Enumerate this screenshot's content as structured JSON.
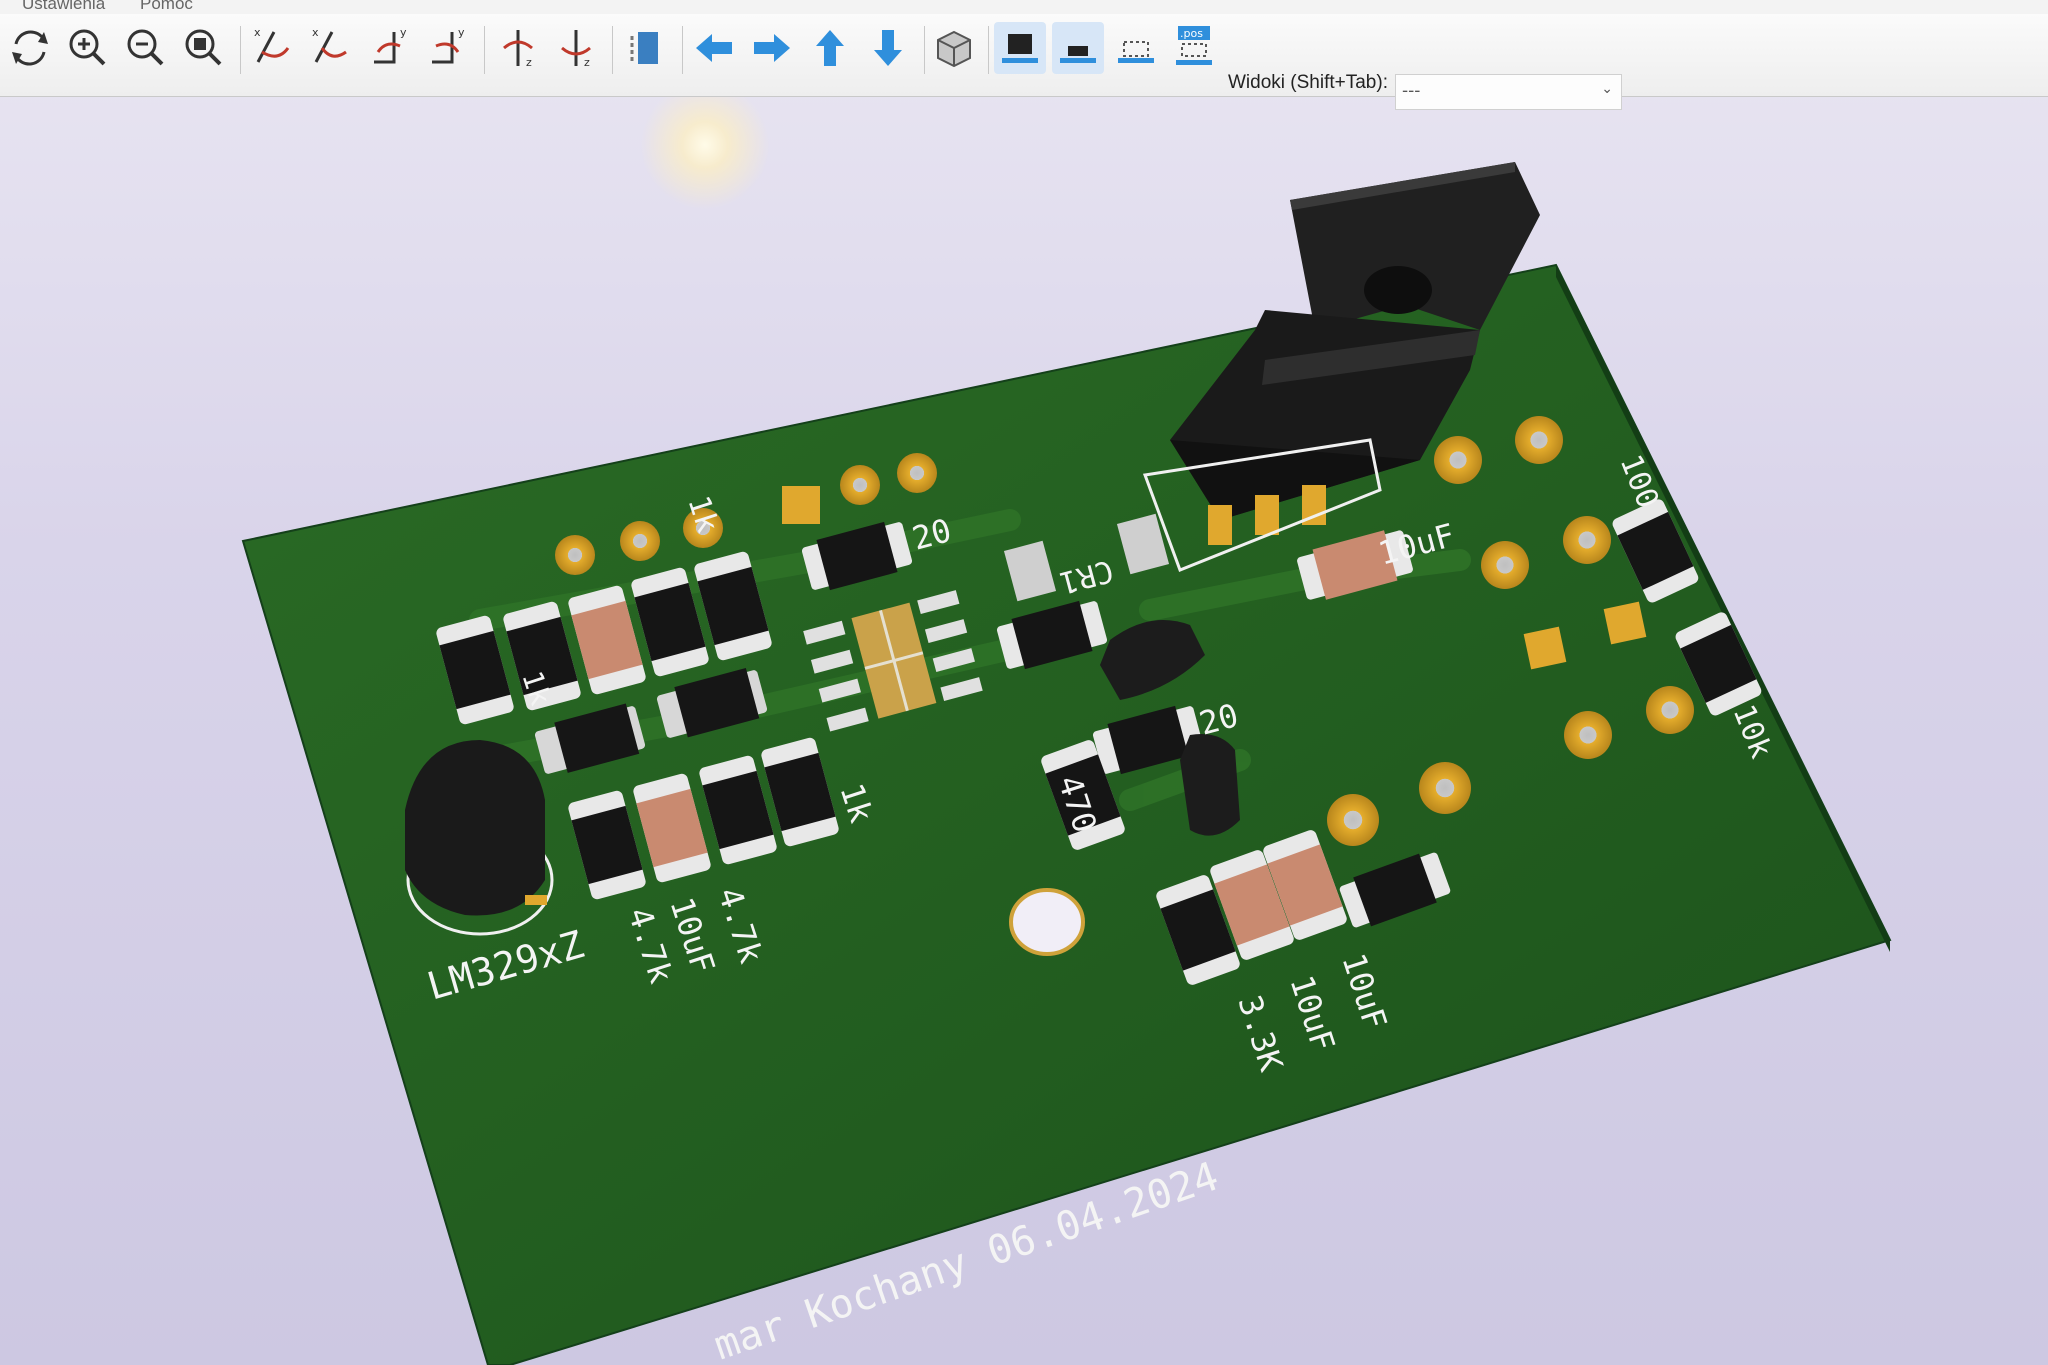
{
  "menu": {
    "items": [
      "Ustawienia",
      "Pomoc"
    ]
  },
  "toolbar": {
    "buttons": [
      {
        "name": "reload-board",
        "icon": "refresh-icon"
      },
      {
        "name": "zoom-in",
        "icon": "zoom-in-icon"
      },
      {
        "name": "zoom-out",
        "icon": "zoom-out-icon"
      },
      {
        "name": "zoom-fit",
        "icon": "zoom-fit-icon"
      },
      {
        "name": "rotate-x-cw",
        "icon": "rotate-x-cw-icon"
      },
      {
        "name": "rotate-x-ccw",
        "icon": "rotate-x-ccw-icon"
      },
      {
        "name": "rotate-y-cw",
        "icon": "rotate-y-cw-icon"
      },
      {
        "name": "rotate-y-ccw",
        "icon": "rotate-y-ccw-icon"
      },
      {
        "name": "rotate-z-cw",
        "icon": "rotate-z-cw-icon"
      },
      {
        "name": "rotate-z-ccw",
        "icon": "rotate-z-ccw-icon"
      },
      {
        "name": "flip-board",
        "icon": "flip-board-icon"
      },
      {
        "name": "move-left",
        "icon": "arrow-left-icon"
      },
      {
        "name": "move-right",
        "icon": "arrow-right-icon"
      },
      {
        "name": "move-up",
        "icon": "arrow-up-icon"
      },
      {
        "name": "move-down",
        "icon": "arrow-down-icon"
      },
      {
        "name": "ortho-toggle",
        "icon": "cube-icon"
      },
      {
        "name": "show-tht",
        "icon": "tht-component-icon"
      },
      {
        "name": "show-smd",
        "icon": "smd-component-icon"
      },
      {
        "name": "show-virtual",
        "icon": "virtual-component-icon"
      },
      {
        "name": "show-pos",
        "icon": "pos-file-icon",
        "label": ".pos"
      }
    ],
    "views": {
      "label": "Widoki (Shift+Tab):",
      "value": "---"
    }
  },
  "board": {
    "labels": {
      "lm329": "LM329xZ",
      "v47k_a": "4.7k",
      "v47k_b": "4.7k",
      "v10uf_a": "10uF",
      "v10uf_b": "10uF",
      "v10uf_c": "10uF",
      "v10uf_d": "10uF",
      "v1k_a": "1k",
      "v1k_b": "1k",
      "v1k_c": "1k",
      "v20_a": "20",
      "v20_b": "20",
      "v470": "470",
      "v33k": "3.3K",
      "v100": "100",
      "v10k": "10k",
      "cr1": "CR1",
      "author": "mar Kochany 06.04.2024"
    }
  },
  "colors": {
    "board": "#1f5a1e",
    "pad": "#e0a82e",
    "silk": "#f4f4f4",
    "component": "#1b1b1b"
  }
}
